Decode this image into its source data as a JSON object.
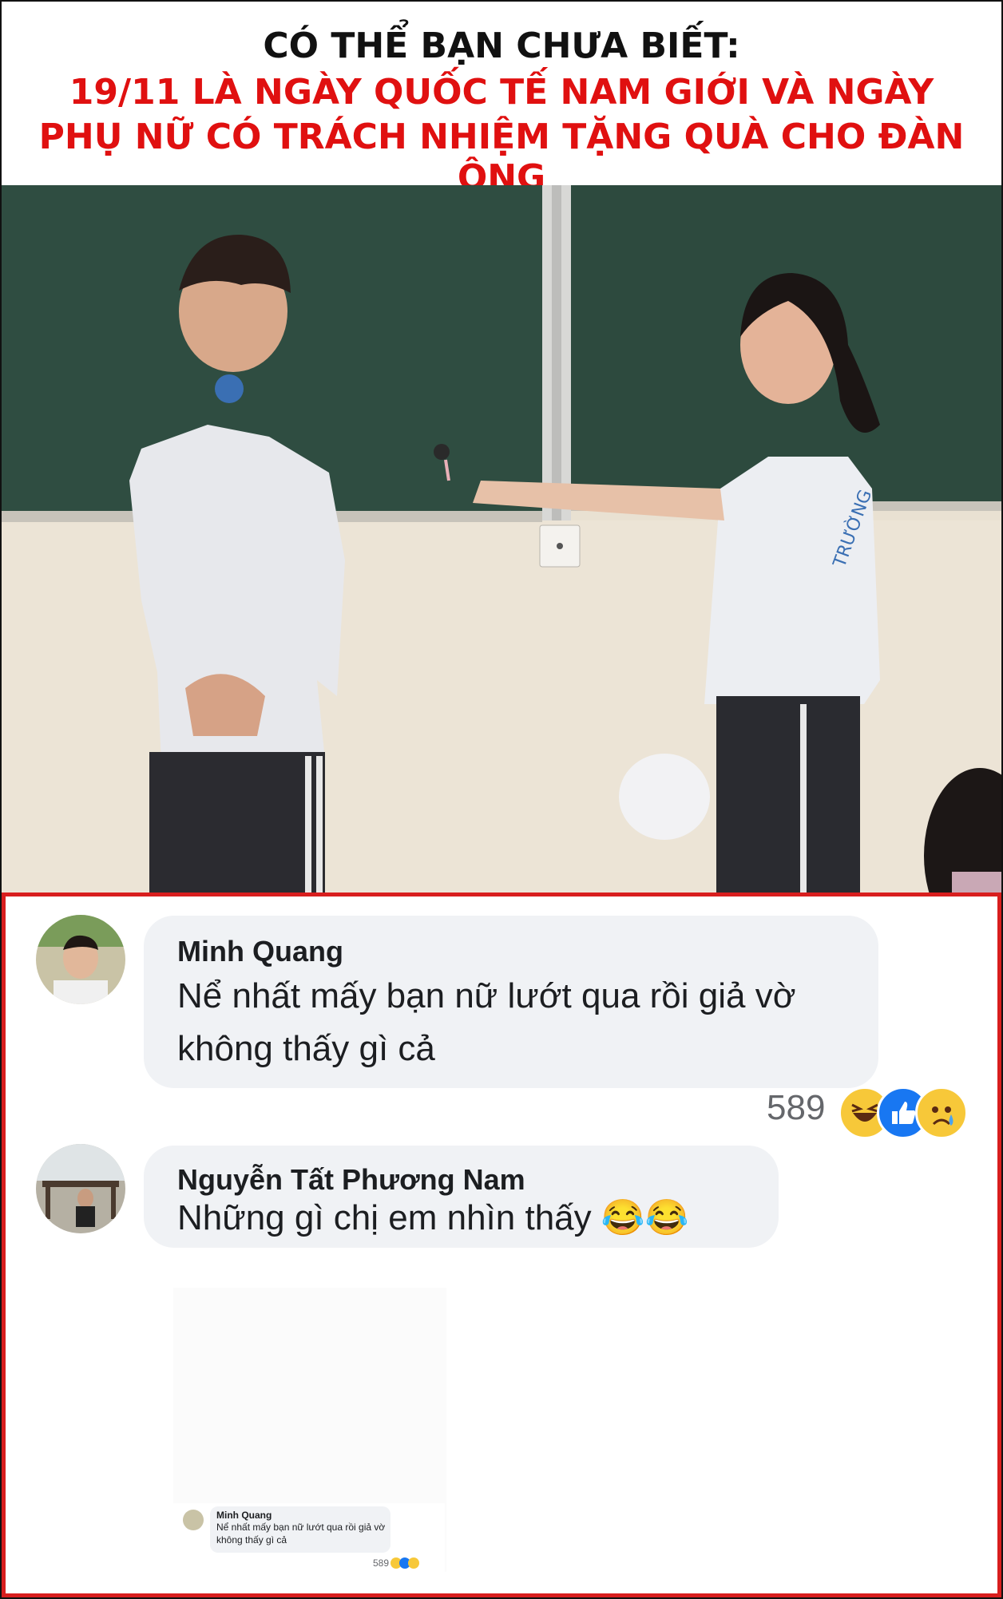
{
  "header": {
    "line1": "CÓ THỂ BẠN CHƯA BIẾT:",
    "line2": "19/11 LÀ NGÀY QUỐC TẾ NAM GIỚI VÀ NGÀY",
    "line3": "PHỤ NỮ CÓ TRÁCH NHIỆM TẶNG QUÀ CHO ĐÀN ÔNG",
    "color_dark": "#111111",
    "color_red": "#e01010"
  },
  "photo": {
    "icon": "classroom-photo"
  },
  "comments": [
    {
      "name": "Minh Quang",
      "text_line1": "Nể nhất mấy bạn nữ lướt qua rồi giả vờ",
      "text_line2": "không thấy gì cả",
      "reaction_count": "589",
      "reactions": [
        "haha-icon",
        "like-icon",
        "sad-icon"
      ]
    },
    {
      "name": "Nguyễn Tất Phương Nam",
      "text": "Những gì chị em nhìn thấy 😂😂"
    }
  ],
  "quoted": {
    "name": "Minh Quang",
    "text_line1": "Nể nhất mấy bạn nữ lướt qua rồi giả vờ",
    "text_line2": "không thấy gì cả",
    "reaction_count": "589"
  },
  "colors": {
    "panel_border": "#d81e1e",
    "bubble_bg": "#f0f2f5",
    "board_green": "#2e4a3f"
  }
}
